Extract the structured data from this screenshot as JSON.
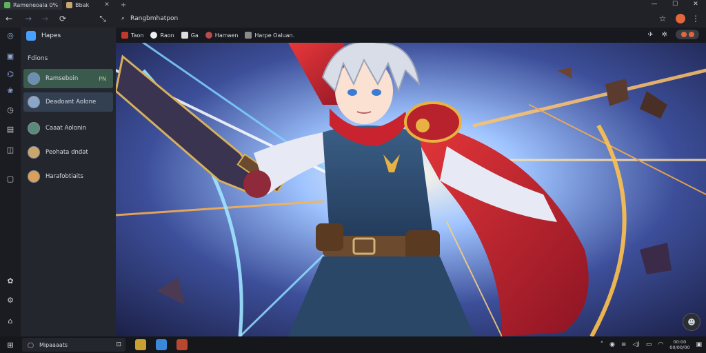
{
  "tabs": [
    {
      "title": "Rameneoala 0%",
      "active": true
    },
    {
      "title": "Bbak",
      "active": false
    }
  ],
  "window_controls": {
    "minimize": "—",
    "maximize": "☐",
    "close": "✕"
  },
  "nav": {
    "back": "←",
    "forward": "→",
    "forward2": "→",
    "reload": "⟳",
    "expand": "⤡"
  },
  "address": {
    "value": "Rangbmhatpon"
  },
  "bookmarks": [
    {
      "label": "Taon"
    },
    {
      "label": "Raon"
    },
    {
      "label": "Ga"
    },
    {
      "label": "Hamaen"
    },
    {
      "label": "Harpe Oaluan."
    }
  ],
  "panel": {
    "header": "Hapes",
    "section": "Fdions",
    "items": [
      {
        "label": "Ramseboin",
        "tag": "PN"
      },
      {
        "label": "Deadoant Aolone",
        "tag": ""
      },
      {
        "label": "Caaat Aolonin",
        "tag": ""
      },
      {
        "label": "Peohata dndat",
        "tag": ""
      },
      {
        "label": "Harafobtiaits",
        "tag": ""
      }
    ]
  },
  "taskbar": {
    "search_placeholder": "Mipaaaats",
    "clock_time": "00:00",
    "clock_date": "00/00/00"
  },
  "colors": {
    "accent": "#4aa0ff",
    "selected_item": "#3b5a4e",
    "hover_item": "#334052"
  }
}
